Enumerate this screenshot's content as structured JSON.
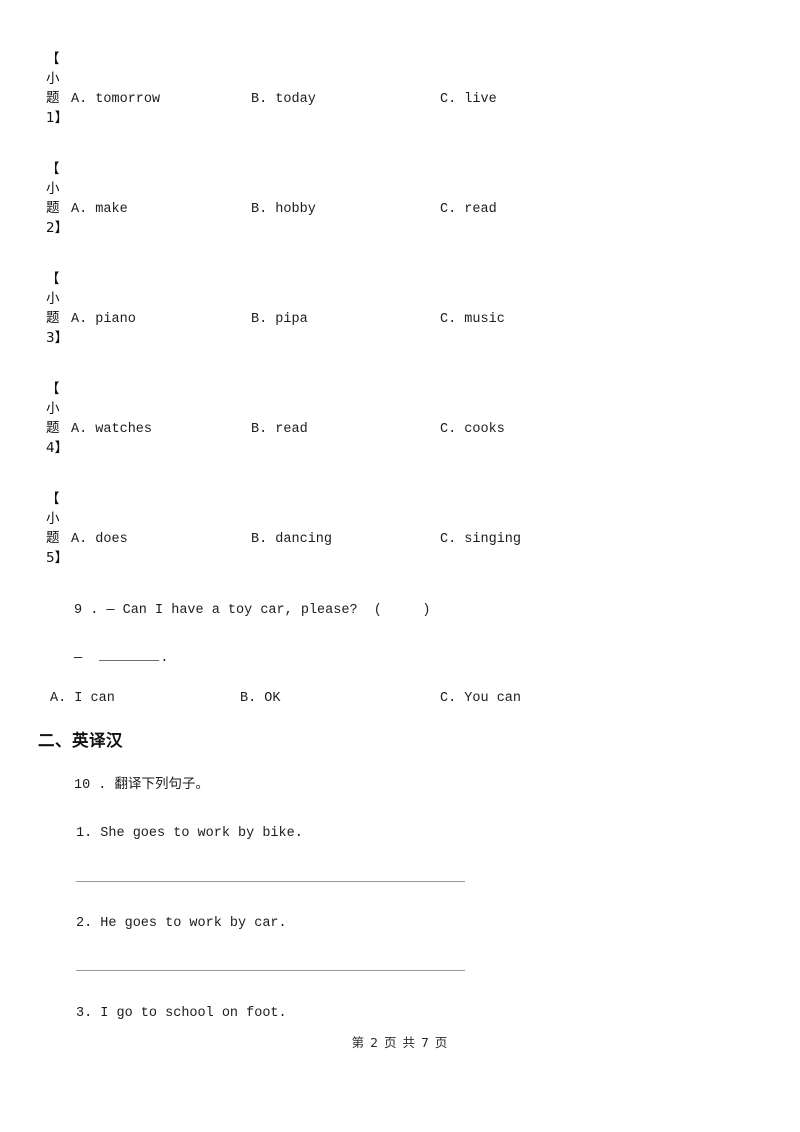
{
  "page": {
    "background_color": "#ffffff",
    "text_color": "#1c1c1c",
    "rule_color": "#9a9a9a"
  },
  "sub_questions": [
    {
      "label": "【\n小\n题\n1】",
      "options": {
        "a": "A. tomorrow",
        "b": "B. today",
        "c": "C. live"
      }
    },
    {
      "label": "【\n小\n题\n2】",
      "options": {
        "a": "A. make",
        "b": "B. hobby",
        "c": "C. read"
      }
    },
    {
      "label": "【\n小\n题\n3】",
      "options": {
        "a": "A. piano",
        "b": "B. pipa",
        "c": "C. music"
      }
    },
    {
      "label": "【\n小\n题\n4】",
      "options": {
        "a": "A. watches",
        "b": "B. read",
        "c": "C. cooks"
      }
    },
    {
      "label": "【\n小\n题\n5】",
      "options": {
        "a": "A. does",
        "b": "B. dancing",
        "c": "C. singing"
      }
    }
  ],
  "question9": {
    "stem": "9 . — Can I have a toy car, please?  (     )",
    "answer_prefix": "—  ",
    "answer_suffix": ".",
    "options": {
      "a": "A. I can",
      "b": "B. OK",
      "c": "C. You can"
    }
  },
  "section2": {
    "heading": "二、英译汉",
    "question10_stem": "10 . 翻译下列句子。",
    "items": [
      "1. She goes to work by bike.",
      "2. He goes to work by car.",
      "3. I go to school on foot."
    ]
  },
  "footer": {
    "text": "第 2 页 共 7 页"
  }
}
